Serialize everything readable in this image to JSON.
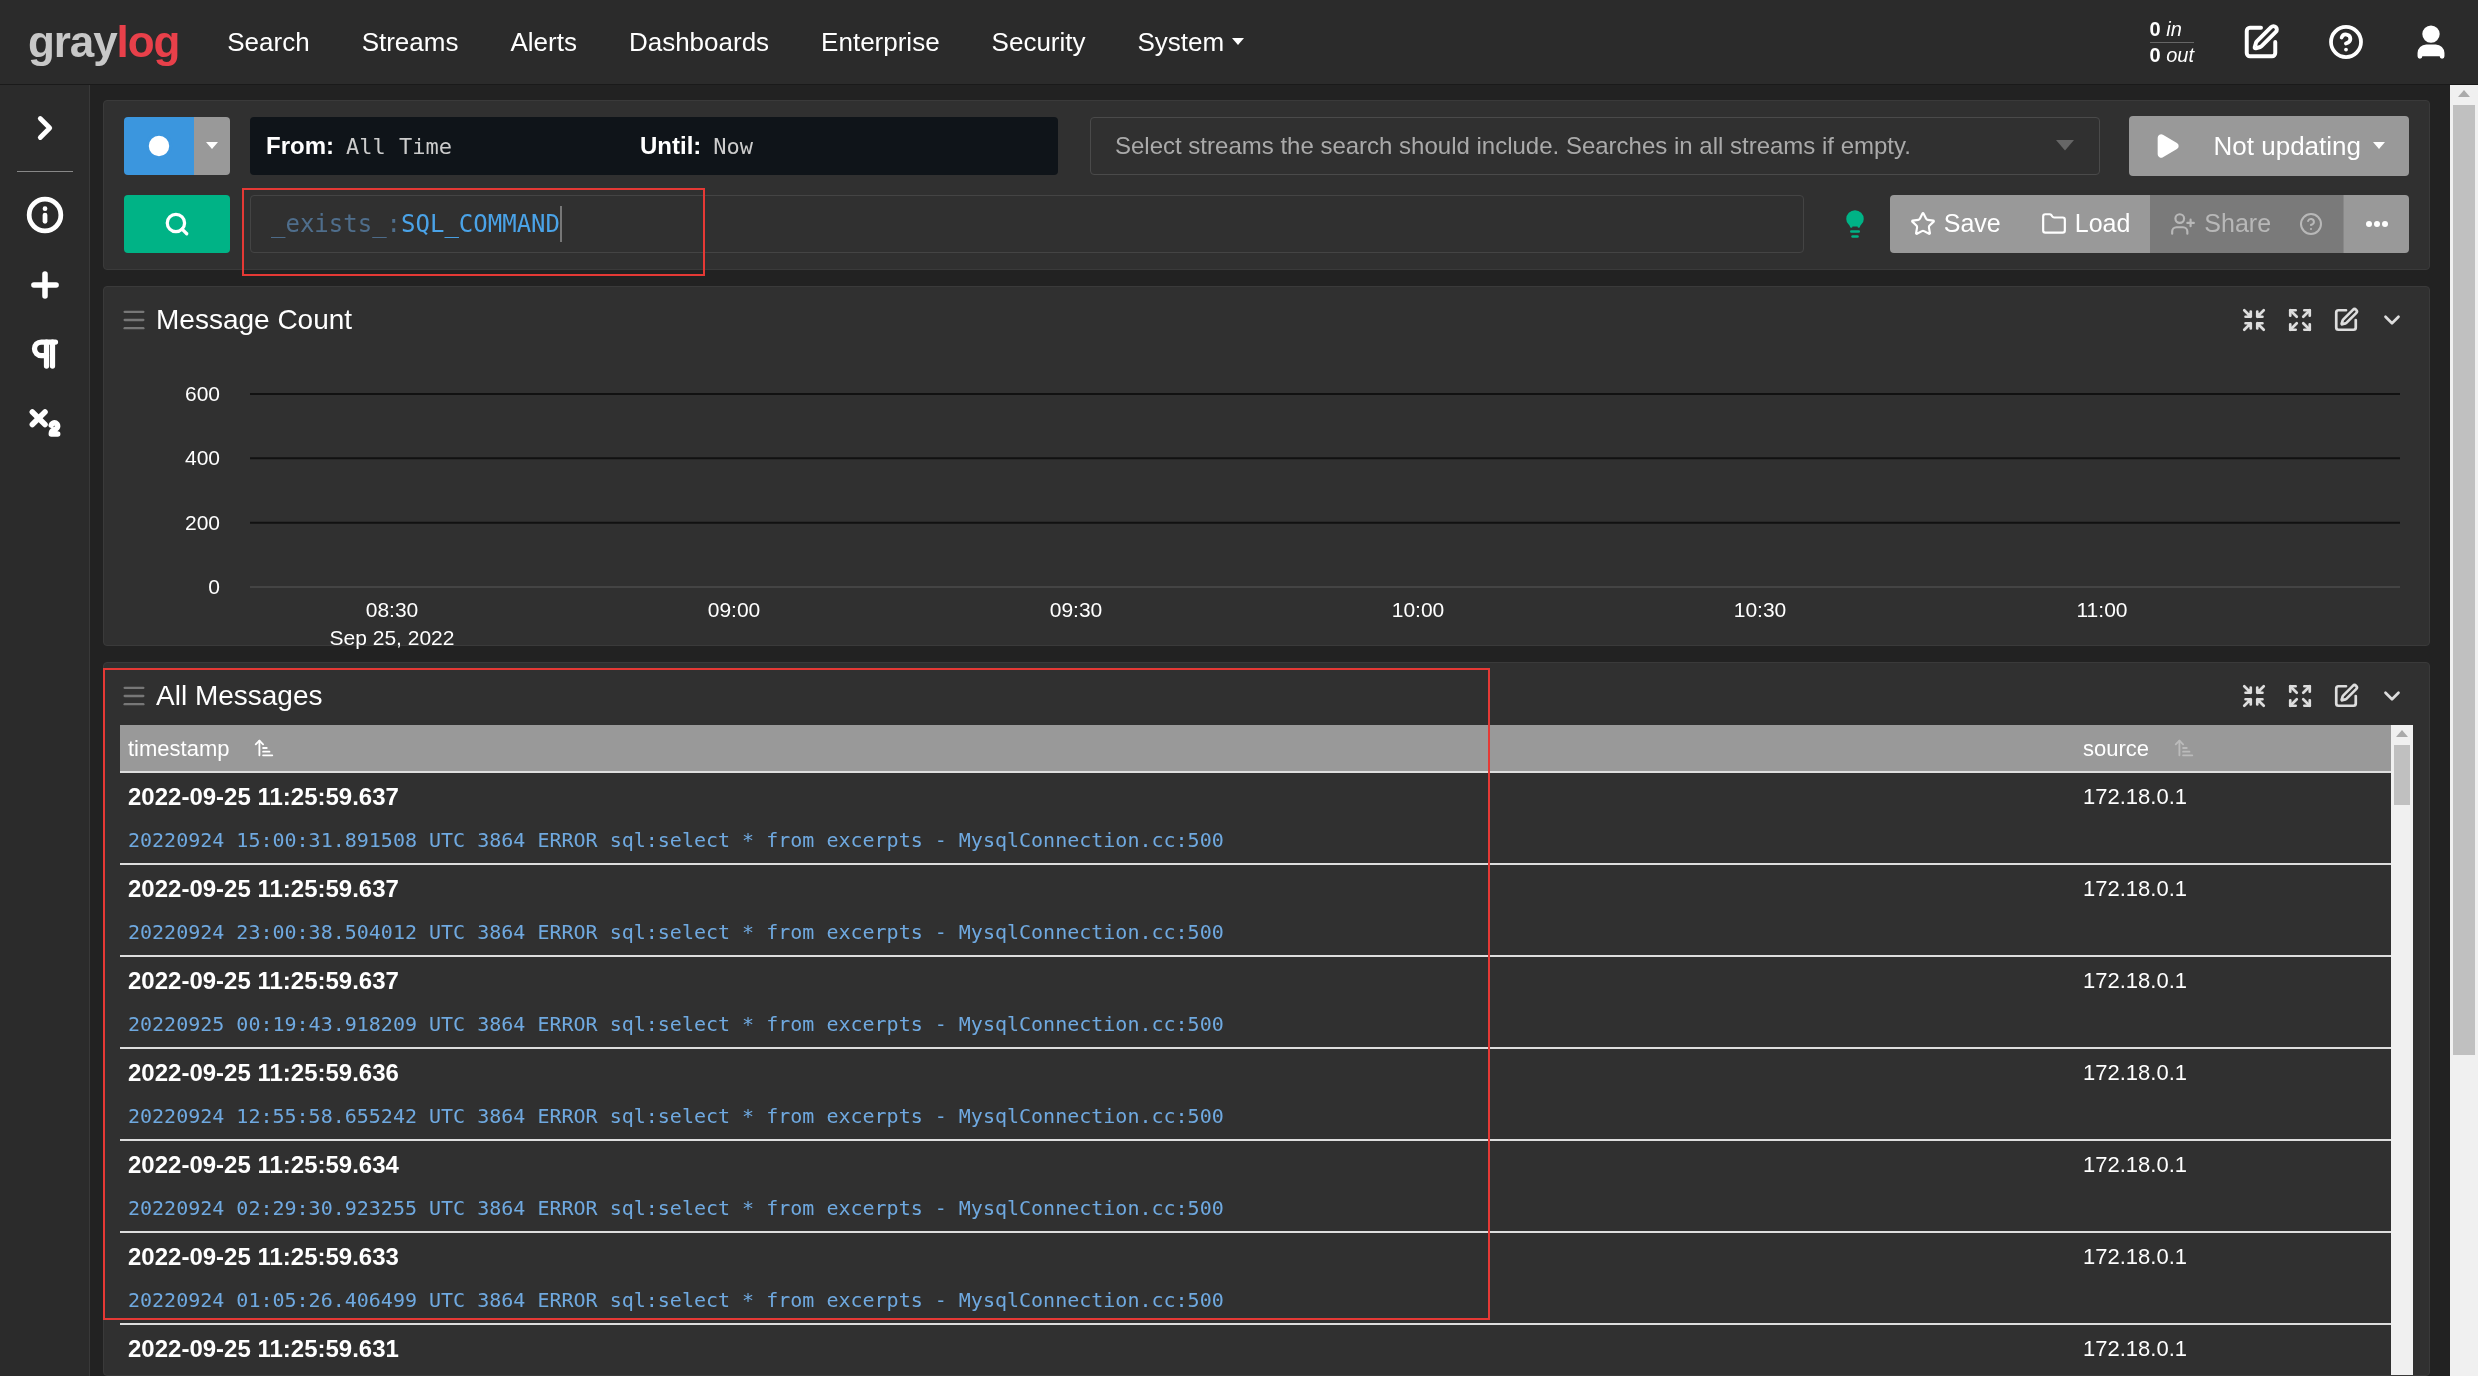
{
  "logo": {
    "part_1": "gray",
    "part_2": "log"
  },
  "nav": [
    {
      "label": "Search",
      "dropdown": false
    },
    {
      "label": "Streams",
      "dropdown": false
    },
    {
      "label": "Alerts",
      "dropdown": false
    },
    {
      "label": "Dashboards",
      "dropdown": false
    },
    {
      "label": "Enterprise",
      "dropdown": false
    },
    {
      "label": "Security",
      "dropdown": false
    },
    {
      "label": "System",
      "dropdown": true
    }
  ],
  "throughput": [
    {
      "count": "0",
      "unit": "in"
    },
    {
      "count": "0",
      "unit": "out"
    }
  ],
  "search_bar": {
    "from_label": "From:",
    "from_value": "All Time",
    "until_label": "Until:",
    "until_value": "Now",
    "streams_placeholder": "Select streams the search should include. Searches in all streams if empty.",
    "refresh_button": "Not updating",
    "query_prefix": "_exists_:",
    "query_value": "SQL_COMMAND",
    "actions": [
      {
        "label": "Save",
        "kind": "save",
        "disabled": false
      },
      {
        "label": "Load",
        "kind": "load",
        "disabled": false
      },
      {
        "label": "Share",
        "kind": "share",
        "disabled": true
      }
    ]
  },
  "message_count": {
    "title": "Message Count",
    "chart_data": {
      "type": "line",
      "yticks": [
        0,
        200,
        400,
        600
      ],
      "ylim": [
        0,
        600
      ],
      "categories": [
        "08:30",
        "09:00",
        "09:30",
        "10:00",
        "10:30",
        "11:00"
      ],
      "annotations": [
        "Sep 25, 2022"
      ]
    }
  },
  "all_messages": {
    "title": "All Messages",
    "columns": [
      "timestamp",
      "source"
    ],
    "rows": [
      {
        "timestamp": "2022-09-25 11:25:59.637",
        "source": "172.18.0.1",
        "message": "20220924 15:00:31.891508 UTC 3864 ERROR sql:select * from excerpts - MysqlConnection.cc:500"
      },
      {
        "timestamp": "2022-09-25 11:25:59.637",
        "source": "172.18.0.1",
        "message": "20220924 23:00:38.504012 UTC 3864 ERROR sql:select * from excerpts - MysqlConnection.cc:500"
      },
      {
        "timestamp": "2022-09-25 11:25:59.637",
        "source": "172.18.0.1",
        "message": "20220925 00:19:43.918209 UTC 3864 ERROR sql:select * from excerpts - MysqlConnection.cc:500"
      },
      {
        "timestamp": "2022-09-25 11:25:59.636",
        "source": "172.18.0.1",
        "message": "20220924 12:55:58.655242 UTC 3864 ERROR sql:select * from excerpts - MysqlConnection.cc:500"
      },
      {
        "timestamp": "2022-09-25 11:25:59.634",
        "source": "172.18.0.1",
        "message": "20220924 02:29:30.923255 UTC 3864 ERROR sql:select * from excerpts - MysqlConnection.cc:500"
      },
      {
        "timestamp": "2022-09-25 11:25:59.633",
        "source": "172.18.0.1",
        "message": "20220924 01:05:26.406499 UTC 3864 ERROR sql:select * from excerpts - MysqlConnection.cc:500"
      },
      {
        "timestamp": "2022-09-25 11:25:59.631",
        "source": "172.18.0.1"
      }
    ]
  }
}
